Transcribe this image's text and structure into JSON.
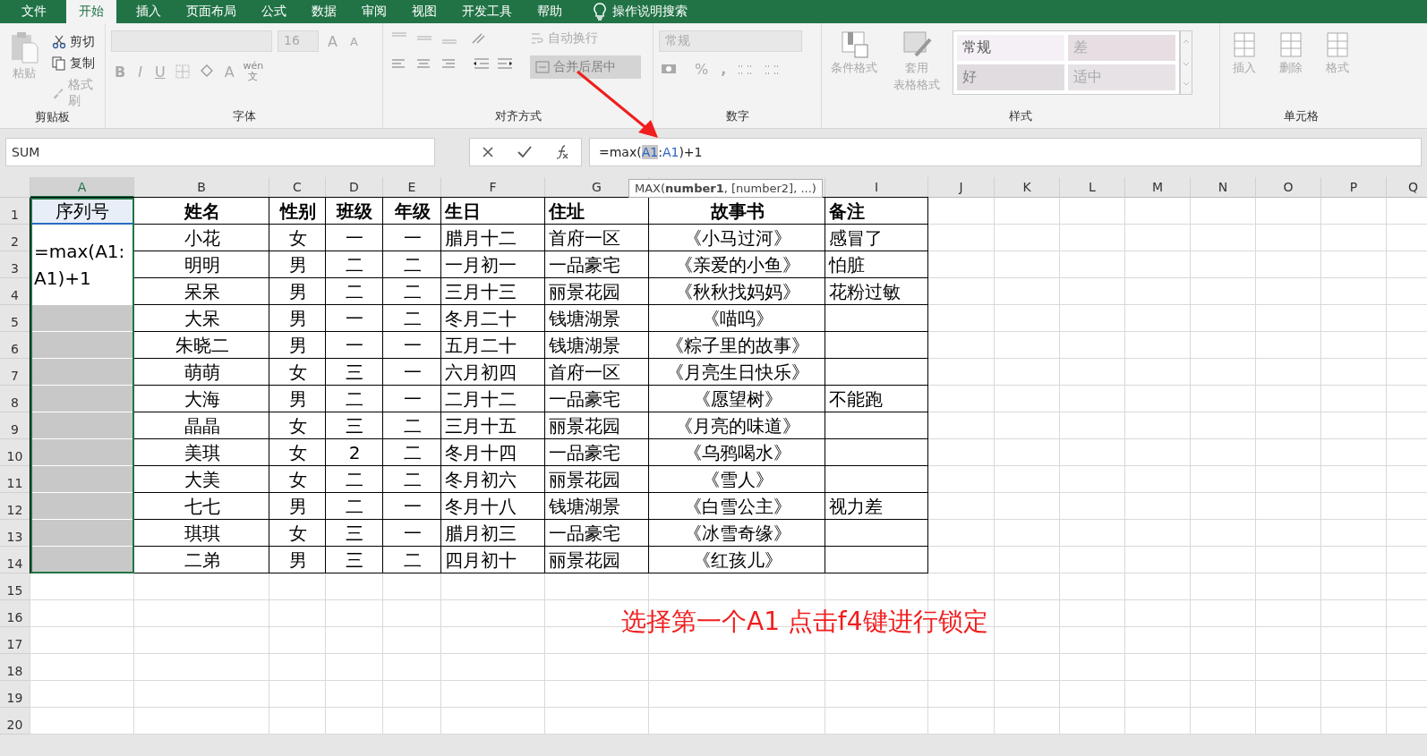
{
  "ribbon_tabs": [
    {
      "label": "文件",
      "selected": false
    },
    {
      "label": "开始",
      "selected": true
    },
    {
      "label": "插入",
      "selected": false
    },
    {
      "label": "页面布局",
      "selected": false
    },
    {
      "label": "公式",
      "selected": false
    },
    {
      "label": "数据",
      "selected": false
    },
    {
      "label": "审阅",
      "selected": false
    },
    {
      "label": "视图",
      "selected": false
    },
    {
      "label": "开发工具",
      "selected": false
    },
    {
      "label": "帮助",
      "selected": false
    }
  ],
  "tell_me": "操作说明搜索",
  "ribbon": {
    "clipboard": {
      "title": "剪贴板",
      "paste": "粘贴",
      "cut": "剪切",
      "copy": "复制",
      "format_painter": "格式刷"
    },
    "font": {
      "title": "字体",
      "font_size": "16",
      "grow": "A",
      "shrink": "A",
      "bold": "B",
      "italic": "I",
      "underline": "U",
      "font_color": "A",
      "phonetic_top": "wén",
      "phonetic_bottom": "文"
    },
    "alignment": {
      "title": "对齐方式",
      "wrap_text": "自动换行",
      "merge_center": "合并后居中"
    },
    "number": {
      "title": "数字",
      "format": "常规",
      "percent": "%",
      "comma": ","
    },
    "styles": {
      "title": "样式",
      "conditional": "条件格式",
      "table_format_1": "套用",
      "table_format_2": "表格格式",
      "cell_styles": [
        {
          "label": "常规",
          "kind": "normal"
        },
        {
          "label": "差",
          "kind": "bad"
        },
        {
          "label": "好",
          "kind": "good"
        },
        {
          "label": "适中",
          "kind": "neutral"
        }
      ]
    },
    "cells": {
      "title": "单元格",
      "insert": "插入",
      "delete": "删除",
      "format": "格式"
    }
  },
  "formula_bar": {
    "name_box": "SUM",
    "formula": [
      {
        "text": "=max(",
        "kind": "plain",
        "highlighted": false
      },
      {
        "text": "A1",
        "kind": "ref",
        "highlighted": true
      },
      {
        "text": ":",
        "kind": "plain",
        "highlighted": false
      },
      {
        "text": "A1",
        "kind": "ref",
        "highlighted": false
      },
      {
        "text": ")+1",
        "kind": "plain",
        "highlighted": false
      }
    ],
    "tooltip": "MAX(**number1**, [number2], ...)"
  },
  "sheet": {
    "columns": [
      {
        "label": "A",
        "selected": true
      },
      {
        "label": "B",
        "selected": false
      },
      {
        "label": "C",
        "selected": false
      },
      {
        "label": "D",
        "selected": false
      },
      {
        "label": "E",
        "selected": false
      },
      {
        "label": "F",
        "selected": false
      },
      {
        "label": "G",
        "selected": false
      },
      {
        "selected": false
      },
      {
        "label": "I",
        "selected": false
      },
      {
        "label": "J",
        "selected": false
      },
      {
        "label": "K",
        "selected": false
      },
      {
        "label": "L",
        "selected": false
      },
      {
        "label": "M",
        "selected": false
      },
      {
        "label": "N",
        "selected": false
      },
      {
        "label": "O",
        "selected": false
      },
      {
        "label": "P",
        "selected": false
      },
      {
        "label": "Q",
        "selected": false
      }
    ],
    "editor_lines": [
      "=max(A1:",
      "A1)+1"
    ],
    "rows": [
      {
        "number": "1",
        "kind": "header",
        "cells": [
          "序列号",
          "姓名",
          "性别",
          "班级",
          "年级",
          "生日",
          "住址",
          "故事书",
          "备注"
        ]
      },
      {
        "number": "2",
        "kind": "data",
        "cells": [
          "",
          "小花",
          "女",
          "一",
          "一",
          "腊月十二",
          "首府一区",
          "《小马过河》",
          "感冒了"
        ]
      },
      {
        "number": "3",
        "kind": "data",
        "cells": [
          "",
          "明明",
          "男",
          "二",
          "二",
          "一月初一",
          "一品豪宅",
          "《亲爱的小鱼》",
          "怕脏"
        ]
      },
      {
        "number": "4",
        "kind": "data",
        "cells": [
          "",
          "呆呆",
          "男",
          "二",
          "二",
          "三月十三",
          "丽景花园",
          "《秋秋找妈妈》",
          "花粉过敏"
        ]
      },
      {
        "number": "5",
        "kind": "data",
        "a_selected": true,
        "cells": [
          "",
          "大呆",
          "男",
          "一",
          "二",
          "冬月二十",
          "钱塘湖景",
          "《喵呜》",
          ""
        ]
      },
      {
        "number": "6",
        "kind": "data",
        "a_selected": true,
        "cells": [
          "",
          "朱晓二",
          "男",
          "一",
          "一",
          "五月二十",
          "钱塘湖景",
          "《粽子里的故事》",
          ""
        ]
      },
      {
        "number": "7",
        "kind": "data",
        "a_selected": true,
        "cells": [
          "",
          "萌萌",
          "女",
          "三",
          "一",
          "六月初四",
          "首府一区",
          "《月亮生日快乐》",
          ""
        ]
      },
      {
        "number": "8",
        "kind": "data",
        "a_selected": true,
        "cells": [
          "",
          "大海",
          "男",
          "二",
          "一",
          "二月十二",
          "一品豪宅",
          "《愿望树》",
          "不能跑"
        ]
      },
      {
        "number": "9",
        "kind": "data",
        "a_selected": true,
        "cells": [
          "",
          "晶晶",
          "女",
          "三",
          "二",
          "三月十五",
          "丽景花园",
          "《月亮的味道》",
          ""
        ]
      },
      {
        "number": "10",
        "kind": "data",
        "a_selected": true,
        "cells": [
          "",
          "美琪",
          "女",
          "2",
          "二",
          "冬月十四",
          "一品豪宅",
          "《乌鸦喝水》",
          ""
        ]
      },
      {
        "number": "11",
        "kind": "data",
        "a_selected": true,
        "cells": [
          "",
          "大美",
          "女",
          "二",
          "二",
          "冬月初六",
          "丽景花园",
          "《雪人》",
          ""
        ]
      },
      {
        "number": "12",
        "kind": "data",
        "a_selected": true,
        "cells": [
          "",
          "七七",
          "男",
          "二",
          "一",
          "冬月十八",
          "钱塘湖景",
          "《白雪公主》",
          "视力差"
        ]
      },
      {
        "number": "13",
        "kind": "data",
        "a_selected": true,
        "cells": [
          "",
          "琪琪",
          "女",
          "三",
          "一",
          "腊月初三",
          "一品豪宅",
          "《冰雪奇缘》",
          ""
        ]
      },
      {
        "number": "14",
        "kind": "data",
        "a_selected": true,
        "cells": [
          "",
          "二弟",
          "男",
          "三",
          "二",
          "四月初十",
          "丽景花园",
          "《红孩儿》",
          ""
        ]
      }
    ],
    "empty_rows": [
      "15",
      "16",
      "17",
      "18",
      "19",
      "20"
    ]
  },
  "annotation": "选择第一个A1 点击f4键进行锁定"
}
